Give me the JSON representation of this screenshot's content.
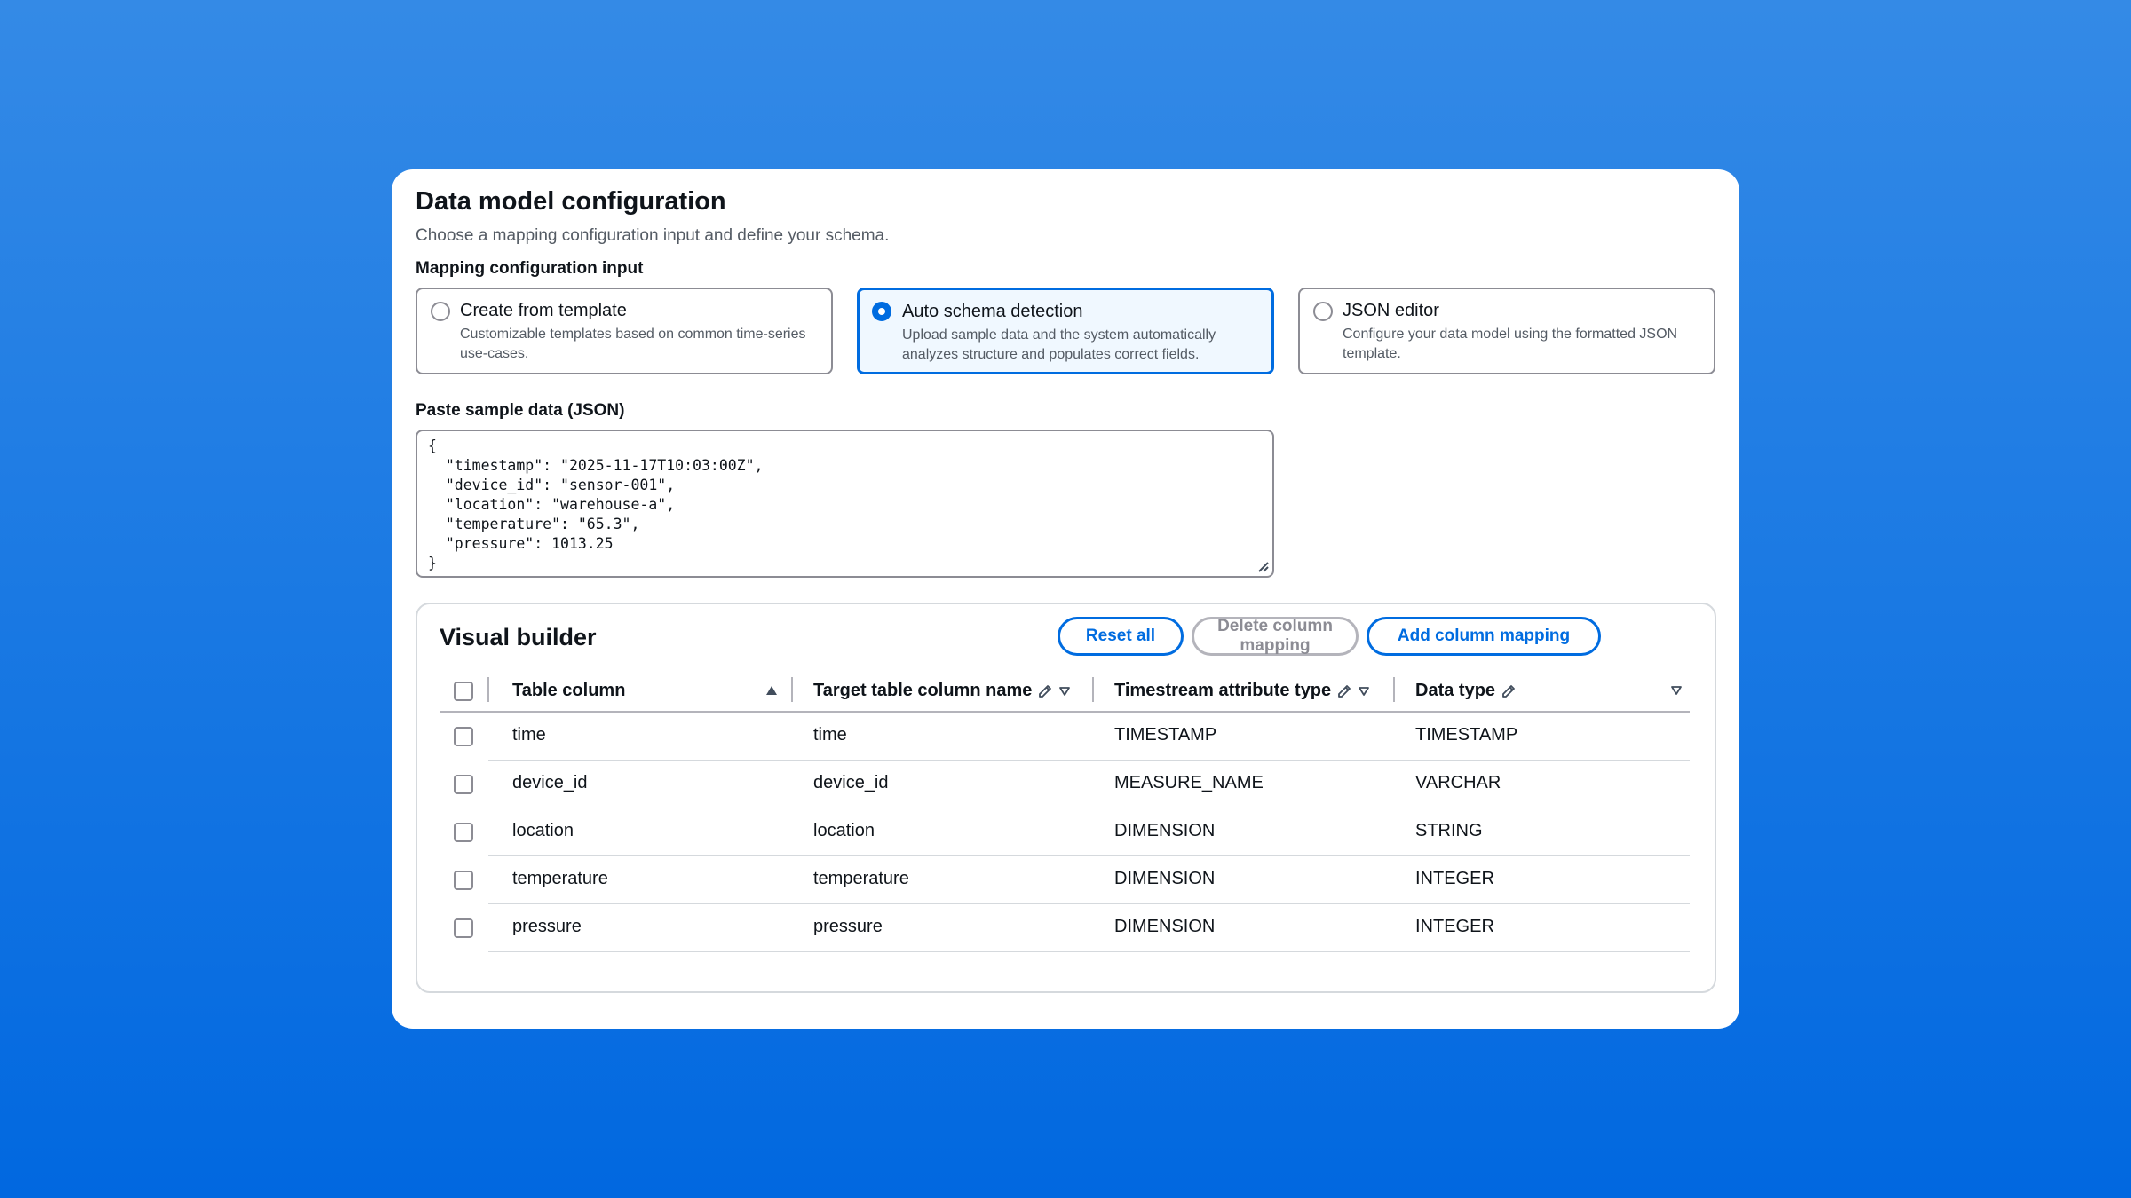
{
  "header": {
    "title": "Data model configuration",
    "subtitle": "Choose a mapping configuration input and define your schema."
  },
  "mapping": {
    "label": "Mapping configuration input",
    "options": [
      {
        "title": "Create from template",
        "desc": "Customizable templates based on common time-series use-cases.",
        "selected": false
      },
      {
        "title": "Auto schema detection",
        "desc": "Upload sample data and the system automatically analyzes structure and populates correct fields.",
        "selected": true
      },
      {
        "title": "JSON editor",
        "desc": "Configure your data model using the formatted JSON template.",
        "selected": false
      }
    ]
  },
  "sample": {
    "label": "Paste sample data (JSON)",
    "lines": [
      "{",
      "  \"timestamp\": \"2025-11-17T10:03:00Z\",",
      "  \"device_id\": \"sensor-001\",",
      "  \"location\": \"warehouse-a\",",
      "  \"temperature\": \"65.3\",",
      "  \"pressure\": 1013.25",
      "}"
    ]
  },
  "builder": {
    "title": "Visual builder",
    "buttons": {
      "reset": "Reset all",
      "delete": "Delete column mapping",
      "add": "Add column mapping"
    },
    "columns": [
      "Table column",
      "Target table column name",
      "Timestream attribute type",
      "Data type"
    ],
    "rows": [
      [
        "time",
        "time",
        "TIMESTAMP",
        "TIMESTAMP"
      ],
      [
        "device_id",
        "device_id",
        "MEASURE_NAME",
        "VARCHAR"
      ],
      [
        "location",
        "location",
        "DIMENSION",
        "STRING"
      ],
      [
        "temperature",
        "temperature",
        "DIMENSION",
        "INTEGER"
      ],
      [
        "pressure",
        "pressure",
        "DIMENSION",
        "INTEGER"
      ]
    ]
  },
  "colors": {
    "accent": "#006ce0",
    "background_top": "#348ae6",
    "background_bottom": "#0168e0"
  }
}
